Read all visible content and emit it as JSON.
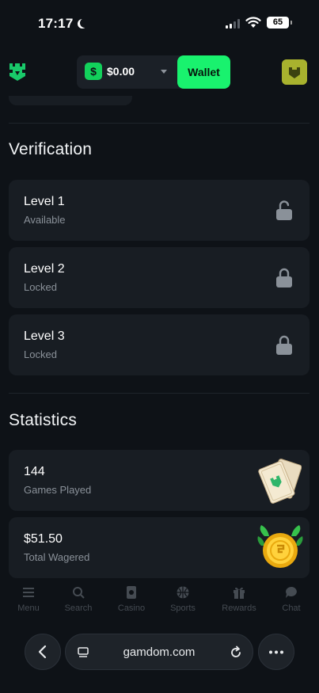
{
  "status_bar": {
    "time": "17:17",
    "battery": "65"
  },
  "header": {
    "balance": "$0.00",
    "currency_symbol": "$",
    "wallet_label": "Wallet"
  },
  "verification": {
    "title": "Verification",
    "levels": [
      {
        "name": "Level 1",
        "status": "Available"
      },
      {
        "name": "Level 2",
        "status": "Locked"
      },
      {
        "name": "Level 3",
        "status": "Locked"
      }
    ]
  },
  "statistics": {
    "title": "Statistics",
    "items": [
      {
        "value": "144",
        "label": "Games Played"
      },
      {
        "value": "$51.50",
        "label": "Total Wagered"
      }
    ]
  },
  "bottom_nav": {
    "items": [
      {
        "label": "Menu",
        "icon": "menu-icon"
      },
      {
        "label": "Search",
        "icon": "search-icon"
      },
      {
        "label": "Casino",
        "icon": "casino-icon"
      },
      {
        "label": "Sports",
        "icon": "sports-icon"
      },
      {
        "label": "Rewards",
        "icon": "gift-icon"
      },
      {
        "label": "Chat",
        "icon": "chat-icon"
      }
    ]
  },
  "browser": {
    "url": "gamdom.com"
  },
  "colors": {
    "background": "#0e1217",
    "card": "#181d23",
    "accent_green": "#19f26e",
    "muted_text": "#8a9199",
    "avatar": "#a8b22e"
  }
}
